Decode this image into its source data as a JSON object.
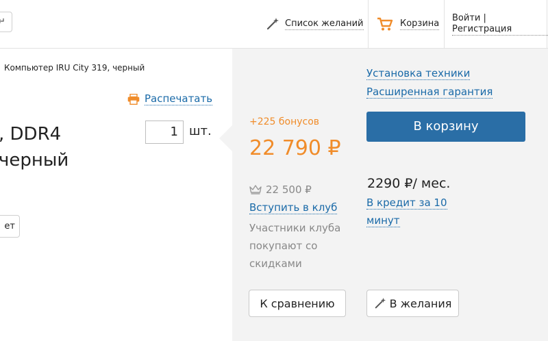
{
  "header": {
    "stub_button": "↵",
    "wishlist_label": "Список желаний",
    "cart_label": "Корзина",
    "auth_label": "Войти | Регистрация"
  },
  "product": {
    "breadcrumb": "Компьютер IRU City 319, черный",
    "print_label": "Распечатать",
    "title_line1": ", DDR4",
    "title_line2": "черный",
    "quantity": "1",
    "quantity_unit": "шт.",
    "left_button_label": "ет"
  },
  "pricing": {
    "bonus": "+225 бонусов",
    "price": "22 790 ₽",
    "club_price": "22 500 ₽",
    "club_join": "Вступить в клуб",
    "club_note": "Участники клуба покупают со скидками"
  },
  "services": {
    "installation": "Установка техники",
    "warranty": "Расширенная гарантия"
  },
  "actions": {
    "add_to_cart": "В корзину",
    "credit_price": "2290 ₽/ мес.",
    "credit_link": "В кредит за 10 минут",
    "compare": "К сравнению",
    "wishlist": "В желания"
  },
  "colors": {
    "accent_orange": "#f08c2a",
    "link_blue": "#1a6aa8",
    "button_blue": "#2a6ea6",
    "panel_grey": "#f3f3f3"
  }
}
